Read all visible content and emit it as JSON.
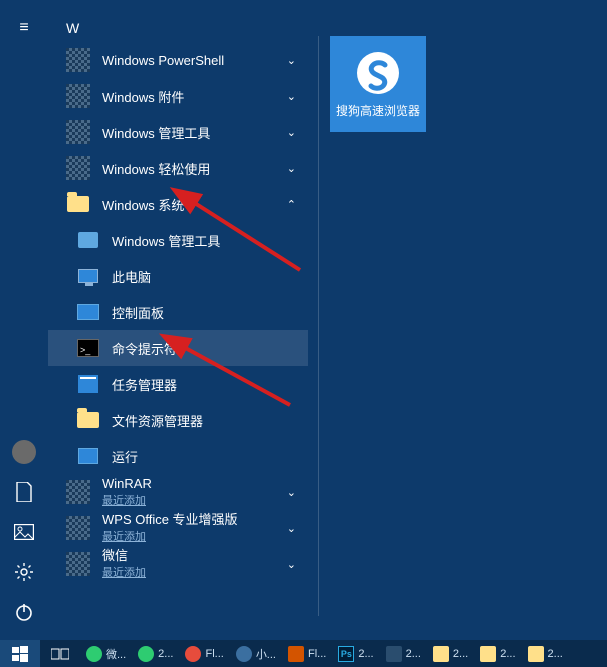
{
  "section_letter": "W",
  "rail": {
    "menu": "≡",
    "user": "user-avatar",
    "docs": "documents",
    "pics": "pictures",
    "settings": "settings",
    "power": "power"
  },
  "apps": [
    {
      "label": "Windows PowerShell",
      "icon": "qr",
      "expand": "down"
    },
    {
      "label": "Windows 附件",
      "icon": "qr",
      "expand": "down"
    },
    {
      "label": "Windows 管理工具",
      "icon": "qr",
      "expand": "down"
    },
    {
      "label": "Windows 轻松使用",
      "icon": "qr",
      "expand": "down"
    },
    {
      "label": "Windows 系统",
      "icon": "folder",
      "expand": "up"
    }
  ],
  "subs": [
    {
      "label": "Windows 管理工具",
      "icon": "gear"
    },
    {
      "label": "此电脑",
      "icon": "pc"
    },
    {
      "label": "控制面板",
      "icon": "panel"
    },
    {
      "label": "命令提示符",
      "icon": "cmd",
      "hover": true
    },
    {
      "label": "任务管理器",
      "icon": "task"
    },
    {
      "label": "文件资源管理器",
      "icon": "folder"
    },
    {
      "label": "运行",
      "icon": "run"
    }
  ],
  "apps2": [
    {
      "label": "WinRAR",
      "sub": "最近添加",
      "icon": "qr",
      "expand": "down"
    },
    {
      "label": "WPS Office 专业增强版",
      "sub": "最近添加",
      "icon": "qr",
      "expand": "down"
    },
    {
      "label": "微信",
      "sub": "最近添加",
      "icon": "qr",
      "expand": "down"
    }
  ],
  "tile": {
    "label": "搜狗高速浏览器"
  },
  "taskbar": {
    "items": [
      {
        "label": "微...",
        "color": "#2ecc71"
      },
      {
        "label": "2...",
        "color": "#2ecc71"
      },
      {
        "label": "Fl...",
        "color": "#e74c3c"
      },
      {
        "label": "小...",
        "color": "#3b6fa0"
      },
      {
        "label": "Fl...",
        "color": "#d35400"
      },
      {
        "label": "2...",
        "color": "#2a4d6e"
      },
      {
        "label": "2...",
        "color": "#ffe08a"
      },
      {
        "label": "2...",
        "color": "#ffe08a"
      },
      {
        "label": "2...",
        "color": "#ffe08a"
      }
    ]
  }
}
